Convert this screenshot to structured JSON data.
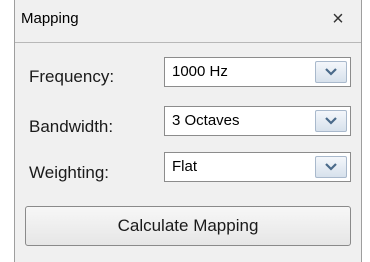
{
  "window": {
    "title": "Mapping",
    "close_glyph": "×"
  },
  "fields": [
    {
      "label": "Frequency:",
      "value": "1000 Hz"
    },
    {
      "label": "Bandwidth:",
      "value": "3 Octaves"
    },
    {
      "label": "Weighting:",
      "value": "Flat"
    }
  ],
  "actions": {
    "calculate_label": "Calculate Mapping"
  },
  "icons": {
    "close": "close-icon",
    "dropdown": "chevron-down-icon"
  }
}
